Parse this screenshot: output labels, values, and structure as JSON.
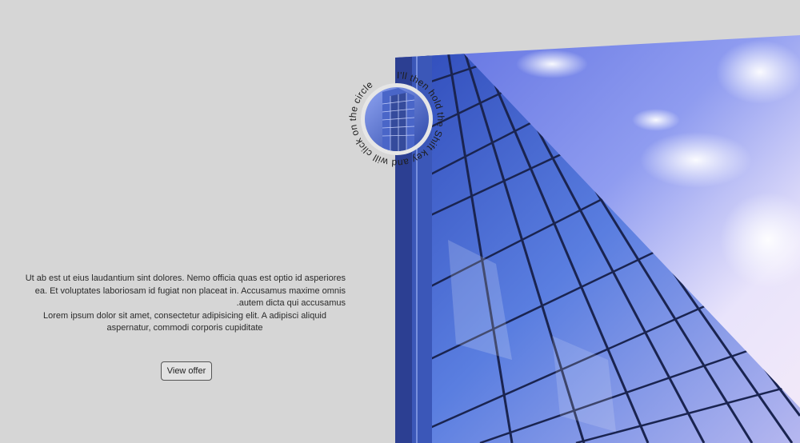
{
  "hero": {
    "paragraph_1": "Ut ab est ut eius laudantium sint dolores. Nemo officia quas est optio id asperiores ea. Et voluptates laboriosam id fugiat non placeat in. Accusamus maxime omnis .autem dicta qui accusamus",
    "paragraph_2": "Lorem ipsum dolor sit amet, consectetur adipisicing elit. A adipisci aliquid aspernatur, commodi corporis cupiditate",
    "cta_label": "View offer"
  },
  "badge": {
    "circular_text": "I'll then hold the Shift key and will click on the circle"
  },
  "colors": {
    "background": "#d6d6d6",
    "sky": "#6f7fe6",
    "glass": "#3f63c8"
  }
}
